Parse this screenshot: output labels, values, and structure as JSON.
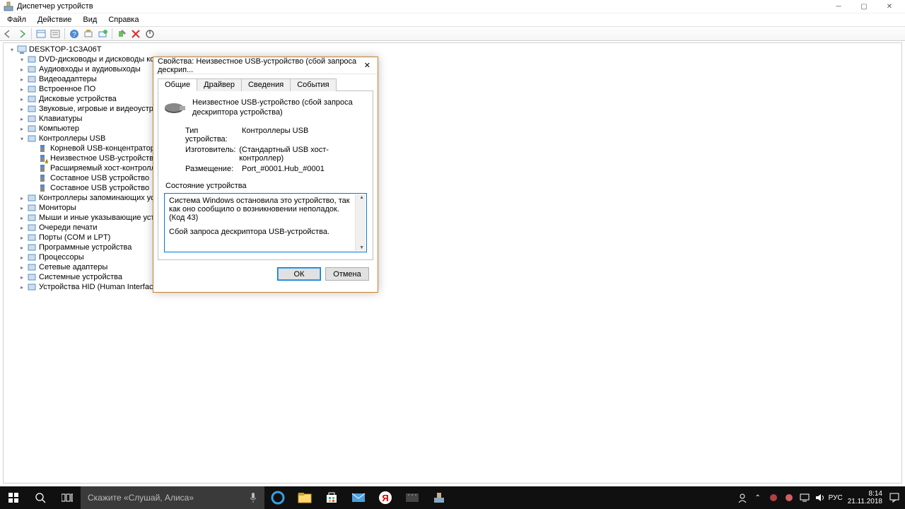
{
  "window": {
    "title": "Диспетчер устройств",
    "menu": [
      "Файл",
      "Действие",
      "Вид",
      "Справка"
    ]
  },
  "tree": {
    "root": "DESKTOP-1C3A06T",
    "categories": [
      {
        "label": "DVD-дисководы и дисководы компа",
        "expanded": true
      },
      {
        "label": "Аудиовходы и аудиовыходы"
      },
      {
        "label": "Видеоадаптеры"
      },
      {
        "label": "Встроенное ПО"
      },
      {
        "label": "Дисковые устройства"
      },
      {
        "label": "Звуковые, игровые и видеоустройств"
      },
      {
        "label": "Клавиатуры"
      },
      {
        "label": "Компьютер"
      },
      {
        "label": "Контроллеры USB",
        "expanded": true,
        "children": [
          {
            "label": "Корневой USB-концентратор (USB"
          },
          {
            "label": "Неизвестное USB-устройство (сбо",
            "warn": true
          },
          {
            "label": "Расширяемый хост-контроллер I"
          },
          {
            "label": "Составное USB устройство"
          },
          {
            "label": "Составное USB устройство"
          }
        ]
      },
      {
        "label": "Контроллеры запоминающих устрой"
      },
      {
        "label": "Мониторы"
      },
      {
        "label": "Мыши и иные указывающие устрой"
      },
      {
        "label": "Очереди печати"
      },
      {
        "label": "Порты (COM и LPT)"
      },
      {
        "label": "Программные устройства"
      },
      {
        "label": "Процессоры"
      },
      {
        "label": "Сетевые адаптеры"
      },
      {
        "label": "Системные устройства"
      },
      {
        "label": "Устройства HID (Human Interface Dev"
      }
    ]
  },
  "dialog": {
    "title": "Свойства: Неизвестное USB-устройство (сбой запроса дескрип...",
    "tabs": [
      "Общие",
      "Драйвер",
      "Сведения",
      "События"
    ],
    "device_name": "Неизвестное USB-устройство (сбой запроса дескриптора устройства)",
    "rows": {
      "type_k": "Тип устройства:",
      "type_v": "Контроллеры USB",
      "mfg_k": "Изготовитель:",
      "mfg_v": "(Стандартный USB хост-контроллер)",
      "loc_k": "Размещение:",
      "loc_v": "Port_#0001.Hub_#0001"
    },
    "status_label": "Состояние устройства",
    "status_line1": "Система Windows остановила это устройство, так как оно сообщило о возникновении неполадок. (Код 43)",
    "status_line2": "Сбой запроса дескриптора USB-устройства.",
    "ok": "ОК",
    "cancel": "Отмена"
  },
  "taskbar": {
    "search_placeholder": "Скажите «Слушай, Алиса»",
    "lang": "РУС",
    "time": "8:14",
    "date": "21.11.2018"
  }
}
